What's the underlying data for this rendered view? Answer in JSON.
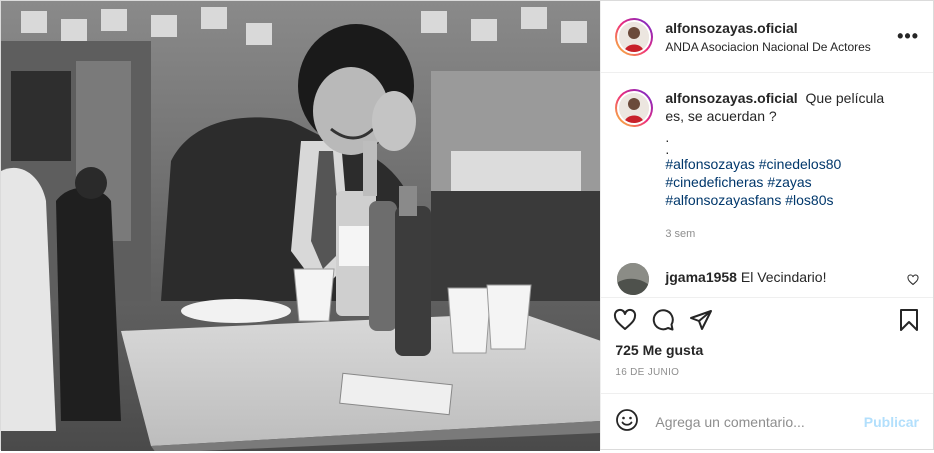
{
  "post": {
    "author": {
      "username": "alfonsozayas.oficial",
      "location": "ANDA Asociacion Nacional De Actores",
      "avatar_icon": "profile-photo"
    },
    "more_glyph": "•••",
    "caption": {
      "username": "alfonsozayas.oficial",
      "text": "Que película es, se acuerdan ?",
      "dot1": ".",
      "dot2": ".",
      "hashtags": [
        "#alfonsozayas",
        "#cinedelos80",
        "#cinedeficheras",
        "#zayas",
        "#alfonsozayasfans",
        "#los80s"
      ],
      "time_ago": "3 sem"
    },
    "comments": [
      {
        "username": "jgama1958",
        "text": "El Vecindario!"
      }
    ],
    "actions": {
      "like_icon": "heart-icon",
      "comment_icon": "comment-icon",
      "share_icon": "paper-plane-icon",
      "save_icon": "bookmark-icon"
    },
    "likes_text": "725 Me gusta",
    "date_text": "16 DE JUNIO",
    "add_comment": {
      "placeholder": "Agrega un comentario...",
      "publish_label": "Publicar",
      "emoji_icon": "smiley-icon"
    },
    "colors": {
      "link": "#00376b",
      "muted": "#8e8e8e",
      "publish_disabled": "#b2dffc",
      "border": "#efefef"
    }
  }
}
